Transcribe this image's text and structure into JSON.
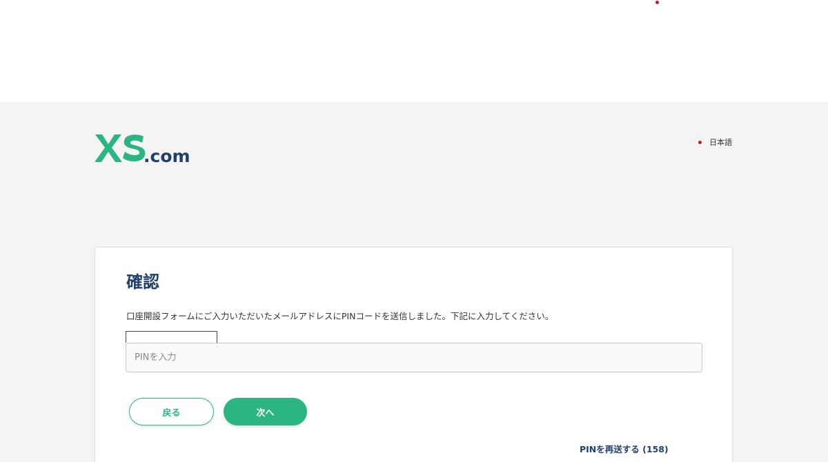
{
  "header": {
    "logo_text": "XS.com",
    "language": "日本語"
  },
  "colors": {
    "brand_green": "#2bb583",
    "brand_navy": "#1f3f6e",
    "page_background": "#f4f4f4"
  },
  "card": {
    "title": "確認",
    "description": "口座開設フォームにご入力いただいたメールアドレスにPINコードを送信しました。下記に入力してください。",
    "pin_placeholder": "PINを入力",
    "pin_value": "",
    "back_label": "戻る",
    "next_label": "次へ",
    "resend_label": "PINを再送する (158)"
  },
  "icons": {
    "language_flag": "japan-flag-icon"
  }
}
